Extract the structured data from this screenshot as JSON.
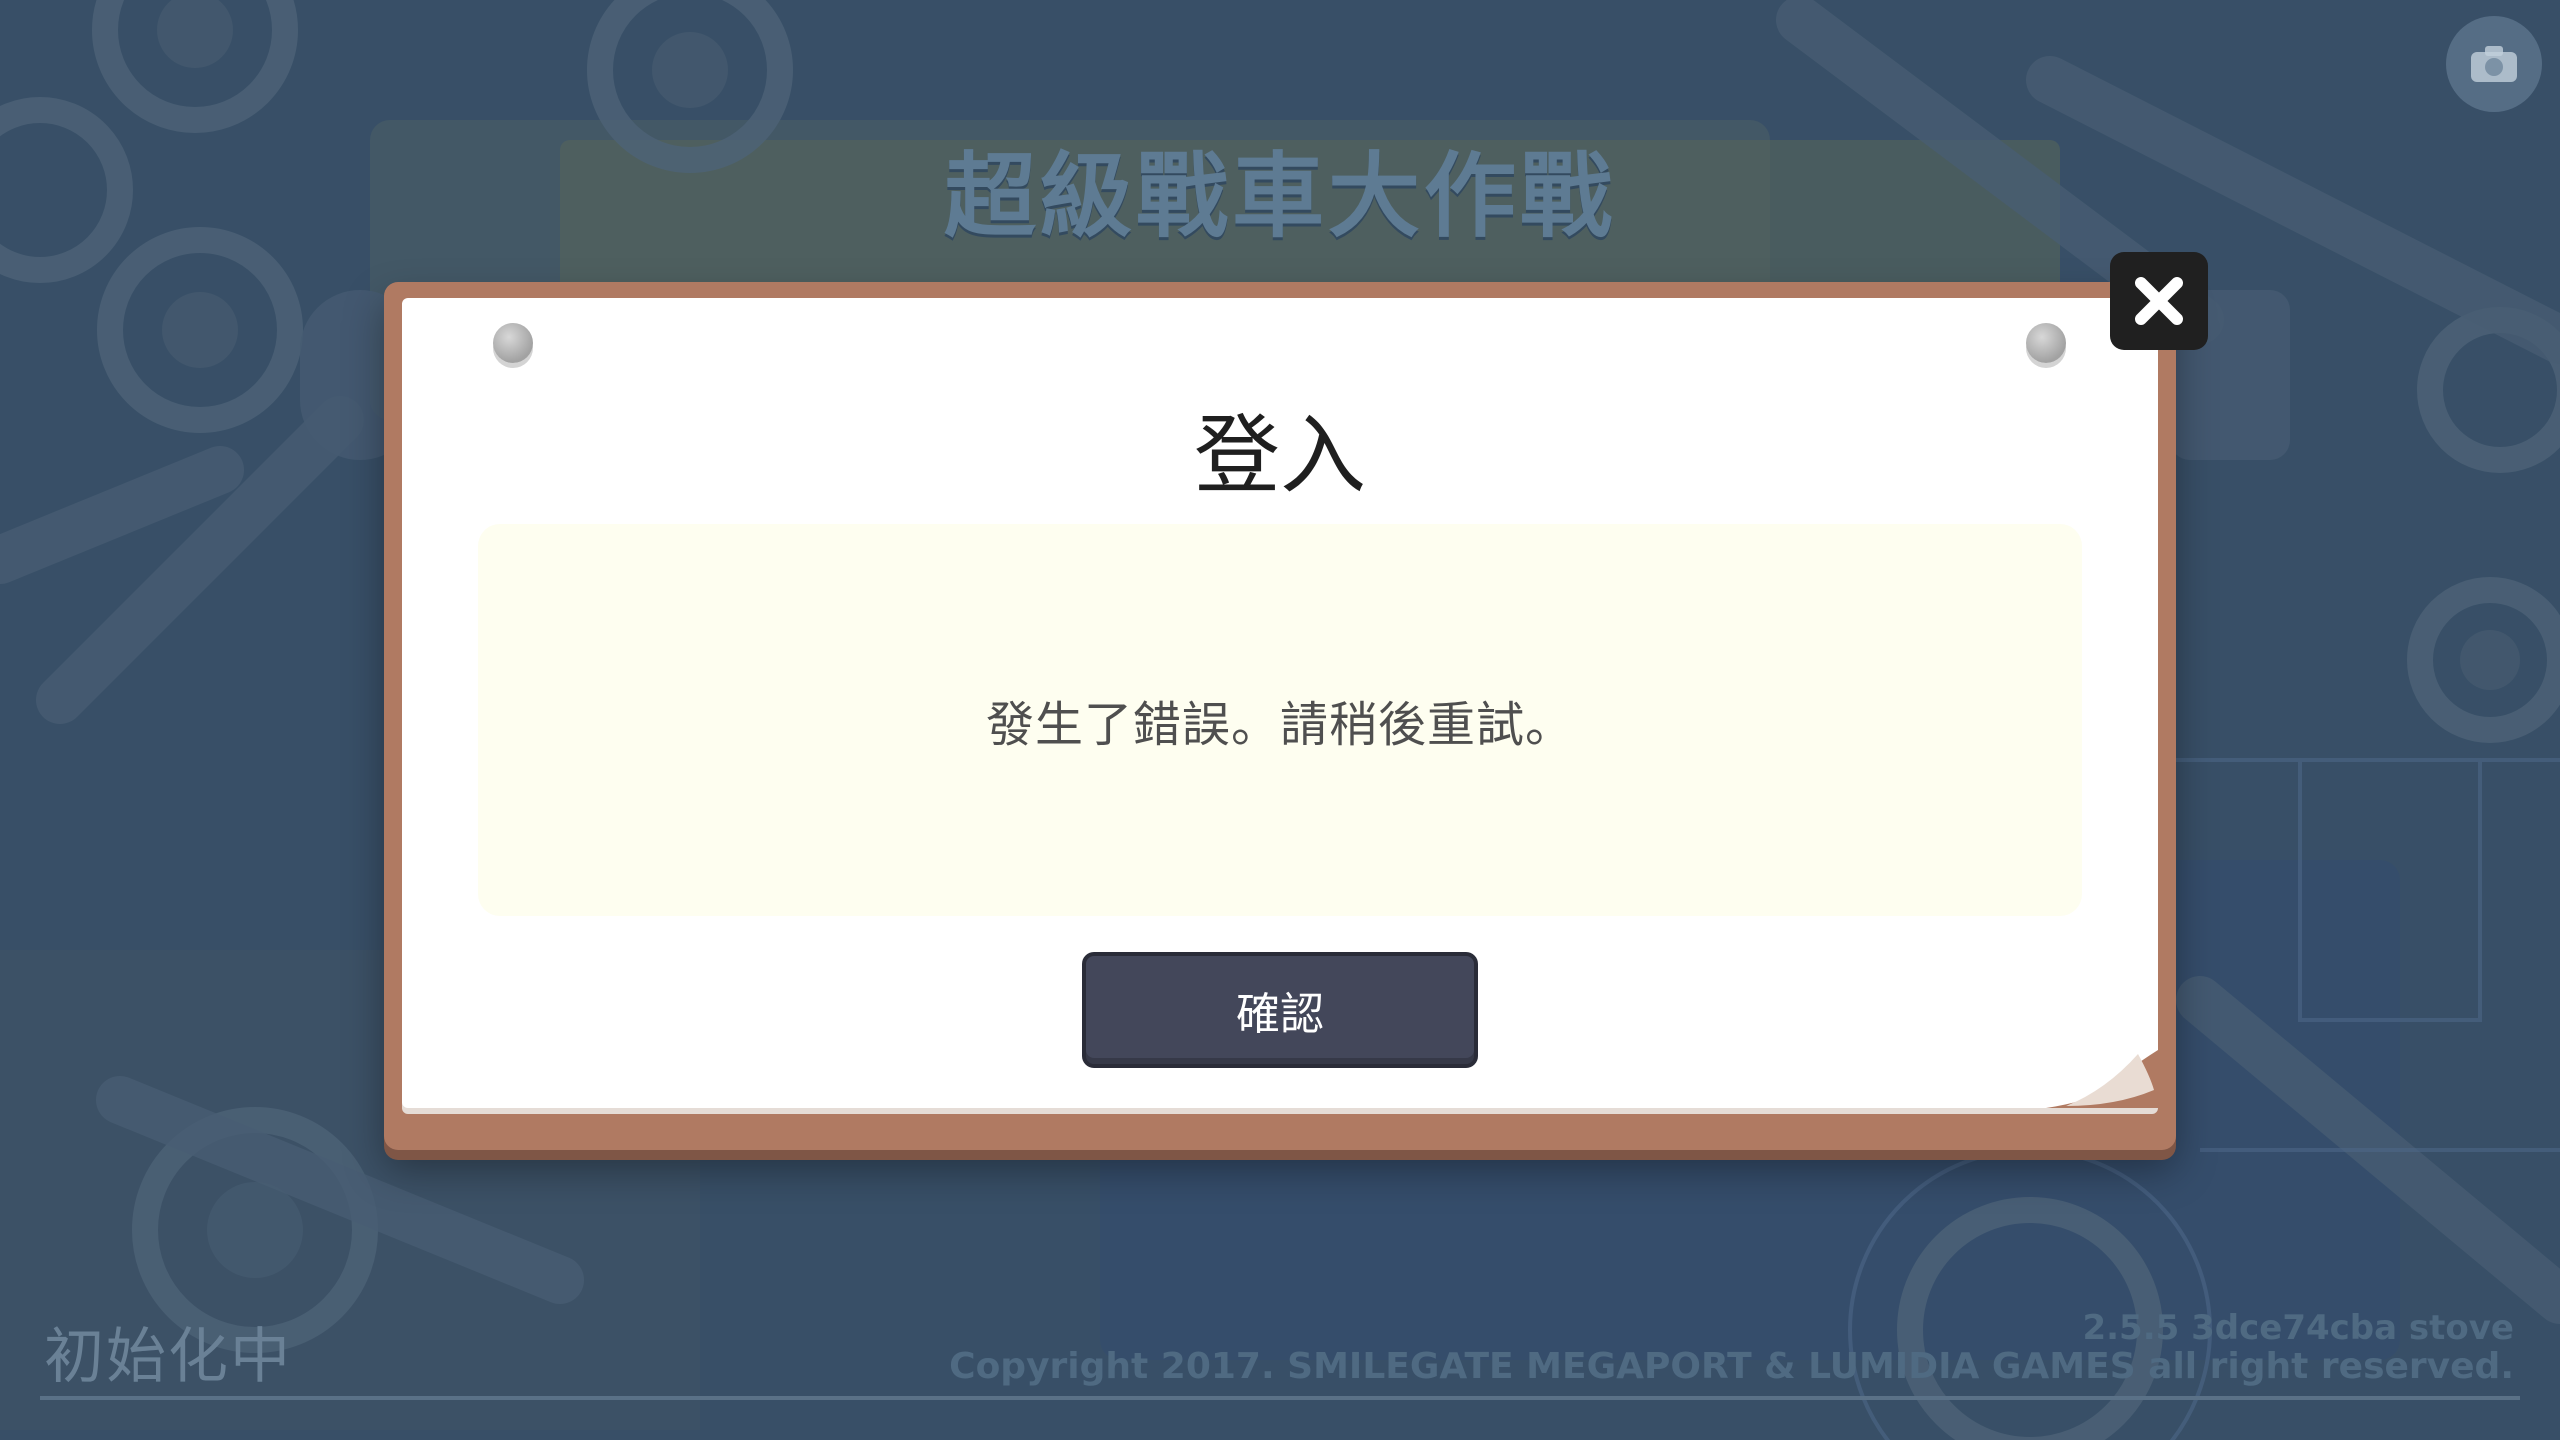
{
  "background": {
    "game_title": "超級戰車大作戰"
  },
  "dialog": {
    "title": "登入",
    "message": "發生了錯誤。請稍後重試。",
    "confirm_label": "確認",
    "close_icon": "close-icon"
  },
  "footer": {
    "status": "初始化中",
    "version": "2.5.5 3dce74cba stove",
    "copyright": "Copyright 2017. SMILEGATE MEGAPORT & LUMIDIA GAMES all right reserved."
  },
  "corner_icon": "camera-icon",
  "colors": {
    "frame": "#b07a62",
    "message_bg": "#fefef0",
    "button": "#43475a",
    "background": "#3f5a73"
  }
}
